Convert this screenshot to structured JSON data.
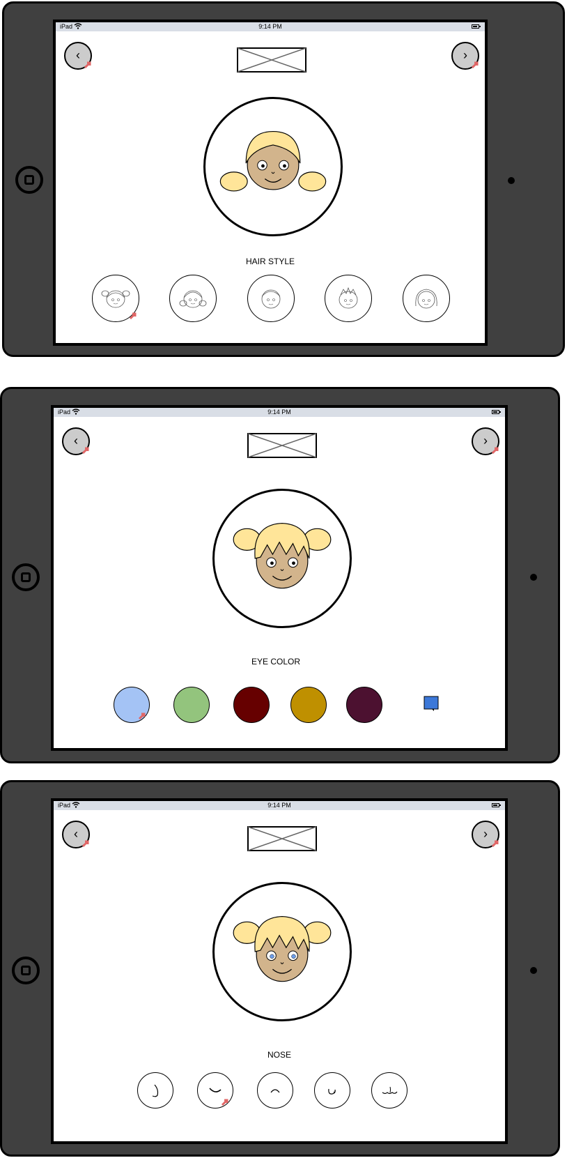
{
  "statusbar": {
    "carrier": "iPad",
    "time": "9:14 PM"
  },
  "nav": {
    "back_icon": "chevron-left-icon",
    "next_icon": "chevron-right-icon",
    "back_glyph": "‹",
    "next_glyph": "›"
  },
  "screens": [
    {
      "title": "HAIR STYLE",
      "options": [
        "hair-style-option-1",
        "hair-style-option-2",
        "hair-style-option-3",
        "hair-style-option-4",
        "hair-style-option-5"
      ]
    },
    {
      "title": "EYE COLOR",
      "swatches": [
        "#a4c3f5",
        "#93c47d",
        "#660000",
        "#bf9000",
        "#4c1130"
      ]
    },
    {
      "title": "NOSE",
      "options": [
        "nose-option-1",
        "nose-option-2",
        "nose-option-3",
        "nose-option-4",
        "nose-option-5"
      ]
    }
  ],
  "colors": {
    "device_frame": "#404040",
    "status_bar": "#d9dee6",
    "nav_button": "#cccccc",
    "link_marker": "#e06666",
    "hair": "#ffe599",
    "skin": "#d2b48c",
    "note_icon": "#3c78d8"
  }
}
